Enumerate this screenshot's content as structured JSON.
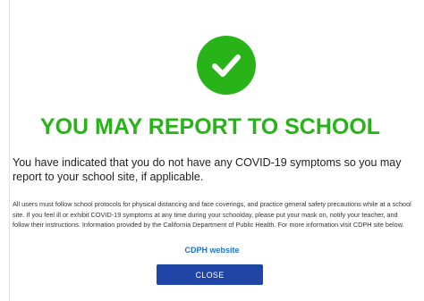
{
  "status": {
    "icon": "check-icon",
    "headline": "YOU MAY REPORT TO SCHOOL",
    "subheadline": "You have indicated that you do not have any COVID-19 symptoms so you may report to your school site, if applicable."
  },
  "info": {
    "body": "All users must follow school protocols for physical distancing and face coverings, and practice general safety precautions while at a school site. If you feel ill or exhibit COVID-19 symptoms at any time during your schoolday, please put your mask on, notify your teacher, and follow their instructions. Information provided by the California Department of Public Health. For more information visit CDPH site below.",
    "link_label": "CDPH website"
  },
  "actions": {
    "close_label": "CLOSE"
  },
  "colors": {
    "success_green": "#28b319",
    "button_blue": "#1f46a6",
    "link_blue": "#1a73d9"
  }
}
